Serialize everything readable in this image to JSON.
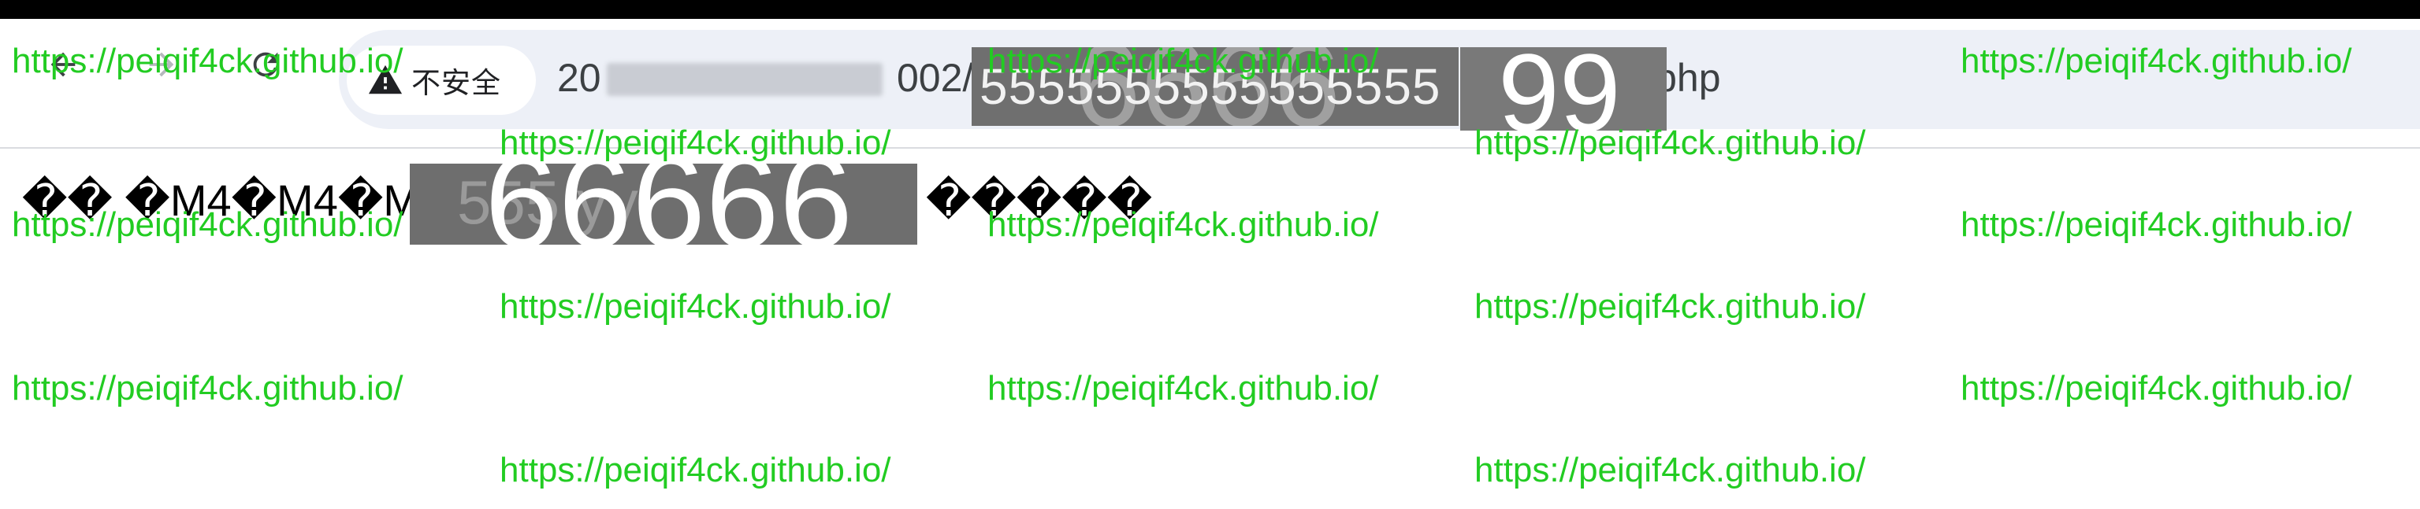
{
  "browser": {
    "nav": {
      "back_icon": "arrow-left-icon",
      "forward_icon": "arrow-right-icon",
      "reload_icon": "reload-icon"
    },
    "security_chip": {
      "icon": "warning-triangle-icon",
      "label": "不安全"
    },
    "url": {
      "prefix": "20",
      "visible_fragment": "002/",
      "suffix": "8b8a.php"
    },
    "overlay_strip": {
      "small_text": "5555555555555555",
      "big_text": "6666"
    },
    "overlay_strip_two": {
      "text": "99"
    }
  },
  "page": {
    "garbled_text": "�� �M4�M4�M4",
    "garbled_tail": "�����",
    "overlay_big_text": "66666",
    "overlay_big_ghost": "555 yy"
  },
  "watermark": {
    "text": "https://peiqif4ck.github.io/",
    "color": "#22cc22"
  },
  "colors": {
    "toolbar_bg": "#ffffff",
    "omnibox_bg": "#edf0f7",
    "top_strip": "#000000",
    "overlay_gray": "#6e6e6e"
  }
}
